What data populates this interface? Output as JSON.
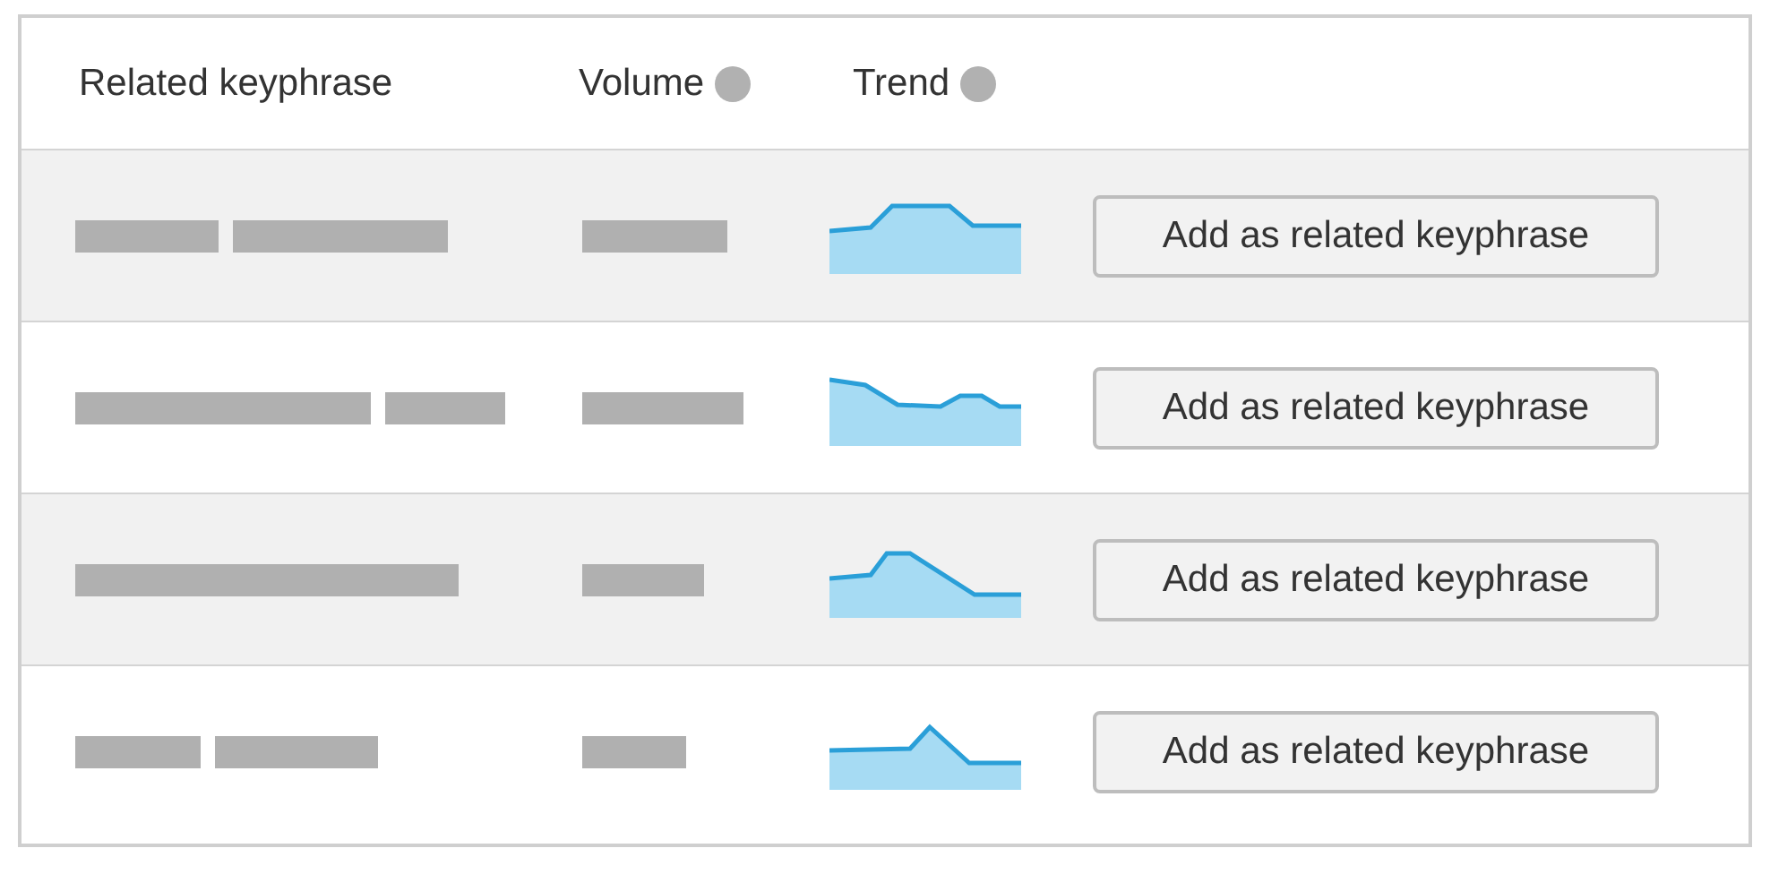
{
  "table": {
    "columns": [
      {
        "label": "Related keyphrase",
        "info_icon": false
      },
      {
        "label": "Volume",
        "info_icon": true
      },
      {
        "label": "Trend",
        "info_icon": true
      }
    ],
    "rows": [
      {
        "button": "Add as related keyphrase"
      },
      {
        "button": "Add as related keyphrase"
      },
      {
        "button": "Add as related keyphrase"
      },
      {
        "button": "Add as related keyphrase"
      }
    ]
  }
}
